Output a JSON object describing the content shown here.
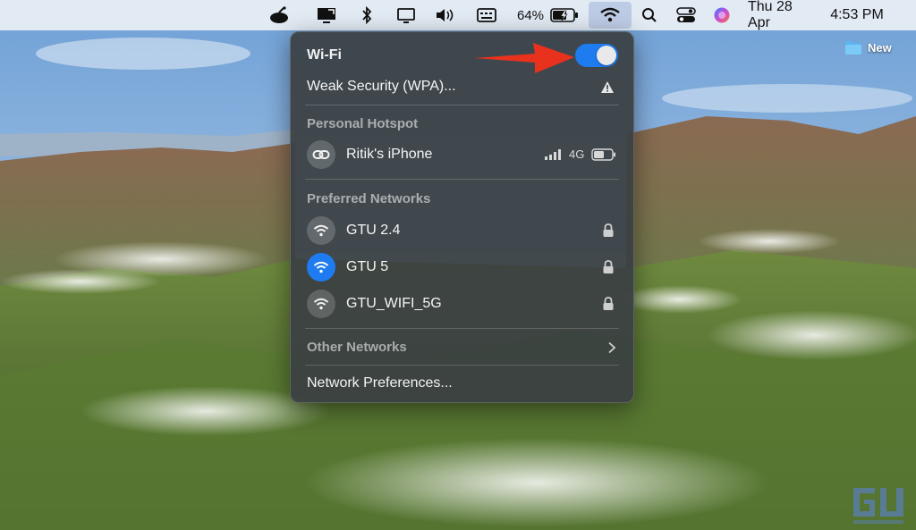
{
  "menubar": {
    "icons": [
      "remote-desktop-icon",
      "share-screen-icon",
      "bluetooth-icon",
      "display-icon",
      "volume-icon",
      "keyboard-icon",
      "battery-charging-icon",
      "wifi-icon",
      "spotlight-search-icon",
      "control-center-icon",
      "siri-icon"
    ],
    "battery_percent": "64%",
    "date": "Thu 28 Apr",
    "time": "4:53 PM"
  },
  "desktop": {
    "folder_label": "New"
  },
  "wifi_panel": {
    "title": "Wi-Fi",
    "toggle_on": true,
    "connected_network": {
      "name": "Weak Security (WPA)...",
      "warning_icon": "warning-icon"
    },
    "personal_hotspot": {
      "label": "Personal Hotspot",
      "device": "Ritik's iPhone",
      "signal": "signal-bars-icon",
      "network_type": "4G",
      "battery": "battery-icon"
    },
    "preferred_networks": {
      "label": "Preferred Networks",
      "items": [
        {
          "name": "GTU 2.4",
          "active": false,
          "locked": true
        },
        {
          "name": "GTU 5",
          "active": true,
          "locked": true
        },
        {
          "name": "GTU_WIFI_5G",
          "active": false,
          "locked": true
        }
      ]
    },
    "other_networks_label": "Other Networks",
    "network_preferences_label": "Network Preferences..."
  },
  "colors": {
    "accent": "#1e7bf0",
    "annotation_arrow": "#e8321e",
    "panel_bg": "#3a4042"
  }
}
